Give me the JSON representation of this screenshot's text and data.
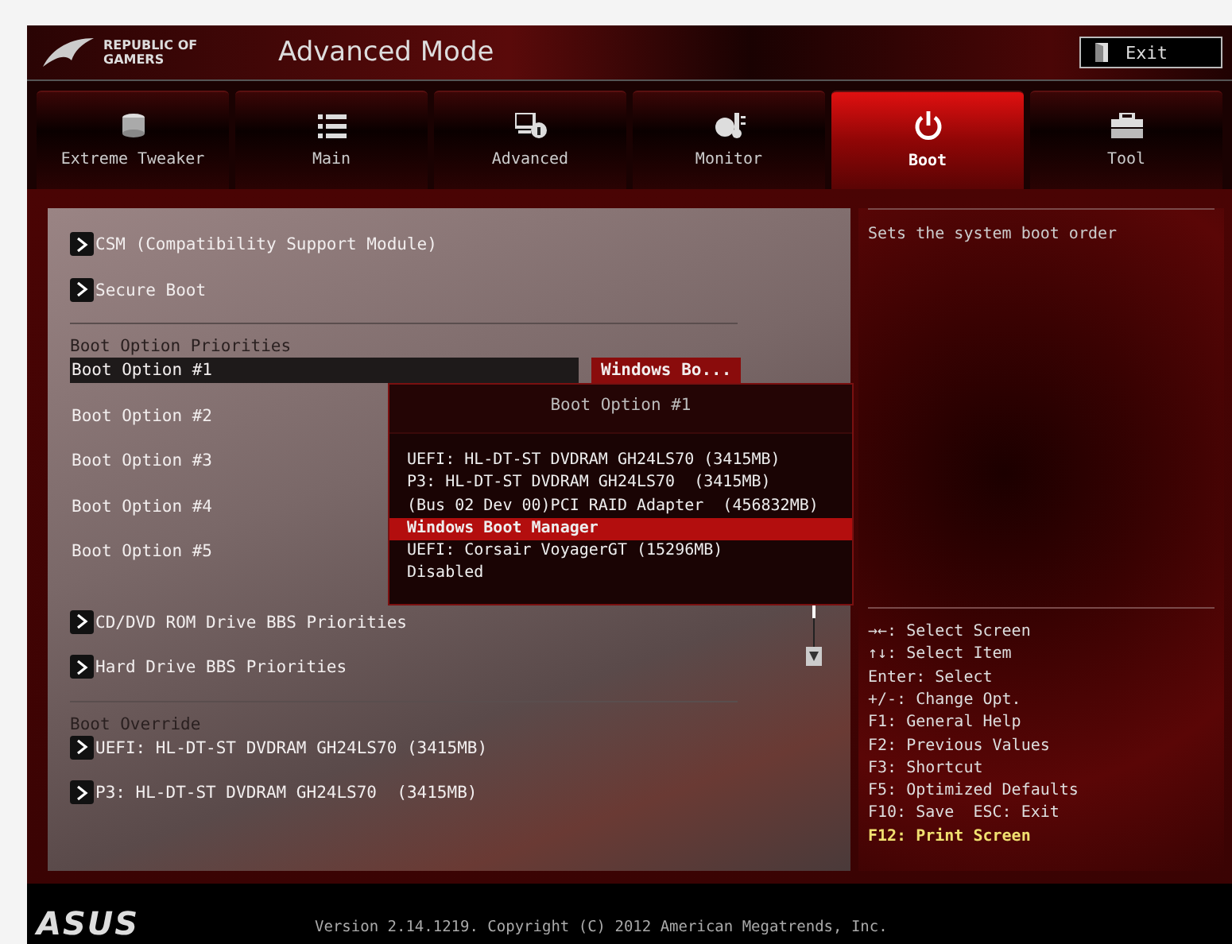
{
  "header": {
    "logo_lines": [
      "REPUBLIC OF",
      "GAMERS"
    ],
    "title": "Advanced Mode",
    "exit_button": "Exit"
  },
  "tabs": [
    {
      "label": "Extreme Tweaker",
      "kind": "tweaker",
      "selected": false
    },
    {
      "label": "Main",
      "kind": "list",
      "selected": false
    },
    {
      "label": "Advanced",
      "kind": "advanced",
      "selected": false
    },
    {
      "label": "Monitor",
      "kind": "monitor",
      "selected": false
    },
    {
      "label": "Boot",
      "kind": "power",
      "selected": true
    },
    {
      "label": "Tool",
      "kind": "toolbox",
      "selected": false
    }
  ],
  "items": [
    {
      "kind": "submenu",
      "label": "CSM (Compatibility Support Module)"
    },
    {
      "kind": "submenu",
      "label": "Secure Boot"
    },
    {
      "kind": "divider"
    },
    {
      "kind": "heading",
      "label": "Boot Option Priorities"
    },
    {
      "kind": "option",
      "label": "Boot Option #1",
      "selected": true,
      "value": "Windows Bo..."
    },
    {
      "kind": "option",
      "label": "Boot Option #2",
      "selected": false
    },
    {
      "kind": "option",
      "label": "Boot Option #3",
      "selected": false
    },
    {
      "kind": "option",
      "label": "Boot Option #4",
      "selected": false
    },
    {
      "kind": "option",
      "label": "Boot Option #5",
      "selected": false
    },
    {
      "kind": "submenu",
      "label": "CD/DVD ROM Drive BBS Priorities"
    },
    {
      "kind": "submenu",
      "label": "Hard Drive BBS Priorities"
    },
    {
      "kind": "divider"
    },
    {
      "kind": "heading",
      "label": "Boot Override"
    },
    {
      "kind": "submenu",
      "label": "UEFI: HL-DT-ST DVDRAM GH24LS70 (3415MB)"
    },
    {
      "kind": "submenu",
      "label": "P3: HL-DT-ST DVDRAM GH24LS70  (3415MB)"
    }
  ],
  "popup": {
    "title": "Boot Option #1",
    "options": [
      {
        "label": "UEFI: HL-DT-ST DVDRAM GH24LS70 (3415MB)",
        "selected": false
      },
      {
        "label": "P3: HL-DT-ST DVDRAM GH24LS70  (3415MB)",
        "selected": false
      },
      {
        "label": "(Bus 02 Dev 00)PCI RAID Adapter  (456832MB)",
        "selected": false
      },
      {
        "label": "Windows Boot Manager",
        "selected": true
      },
      {
        "label": "UEFI: Corsair VoyagerGT (15296MB)",
        "selected": false
      },
      {
        "label": "Disabled",
        "selected": false
      }
    ]
  },
  "help": {
    "description": "Sets the system boot order",
    "keys": [
      {
        "text": "→←: Select Screen",
        "highlighted": false
      },
      {
        "text": "↑↓: Select Item",
        "highlighted": false
      },
      {
        "text": "Enter: Select",
        "highlighted": false
      },
      {
        "text": "+/-: Change Opt.",
        "highlighted": false
      },
      {
        "text": "F1: General Help",
        "highlighted": false
      },
      {
        "text": "F2: Previous Values",
        "highlighted": false
      },
      {
        "text": "F3: Shortcut",
        "highlighted": false
      },
      {
        "text": "F5: Optimized Defaults",
        "highlighted": false
      },
      {
        "text": "F10: Save  ESC: Exit",
        "highlighted": false
      },
      {
        "text": "F12: Print Screen",
        "highlighted": true
      }
    ]
  },
  "footer": {
    "logo": "ASUS",
    "version": "Version 2.14.1219. Copyright (C) 2012 American Megatrends, Inc."
  }
}
